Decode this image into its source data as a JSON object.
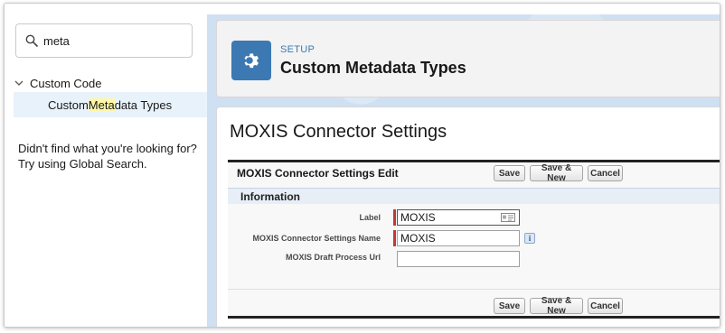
{
  "sidebar": {
    "search_value": "meta",
    "search_icon": "search-icon",
    "group_label": "Custom Code",
    "item": {
      "prefix": "Custom ",
      "highlight": "Meta",
      "suffix": "data Types"
    },
    "not_found_line1": "Didn't find what you're looking for?",
    "not_found_line2": "Try using Global Search."
  },
  "header": {
    "setup_label": "SETUP",
    "title": "Custom Metadata Types",
    "icon": "gear-icon"
  },
  "page": {
    "title": "MOXIS Connector Settings",
    "edit_title": "MOXIS Connector Settings Edit",
    "buttons": {
      "save": "Save",
      "save_new": "Save & New",
      "cancel": "Cancel"
    },
    "section_title": "Information",
    "fields": {
      "label": {
        "label": "Label",
        "value": "MOXIS"
      },
      "name": {
        "label": "MOXIS Connector Settings Name",
        "value": "MOXIS"
      },
      "url": {
        "label": "MOXIS Draft Process Url",
        "value": ""
      }
    },
    "info_glyph": "i"
  },
  "colors": {
    "accent": "#3c79b3",
    "required": "#c23934",
    "highlight": "#fff7a8",
    "selected_row": "#e8f2fb",
    "background": "#cfe0f2"
  }
}
